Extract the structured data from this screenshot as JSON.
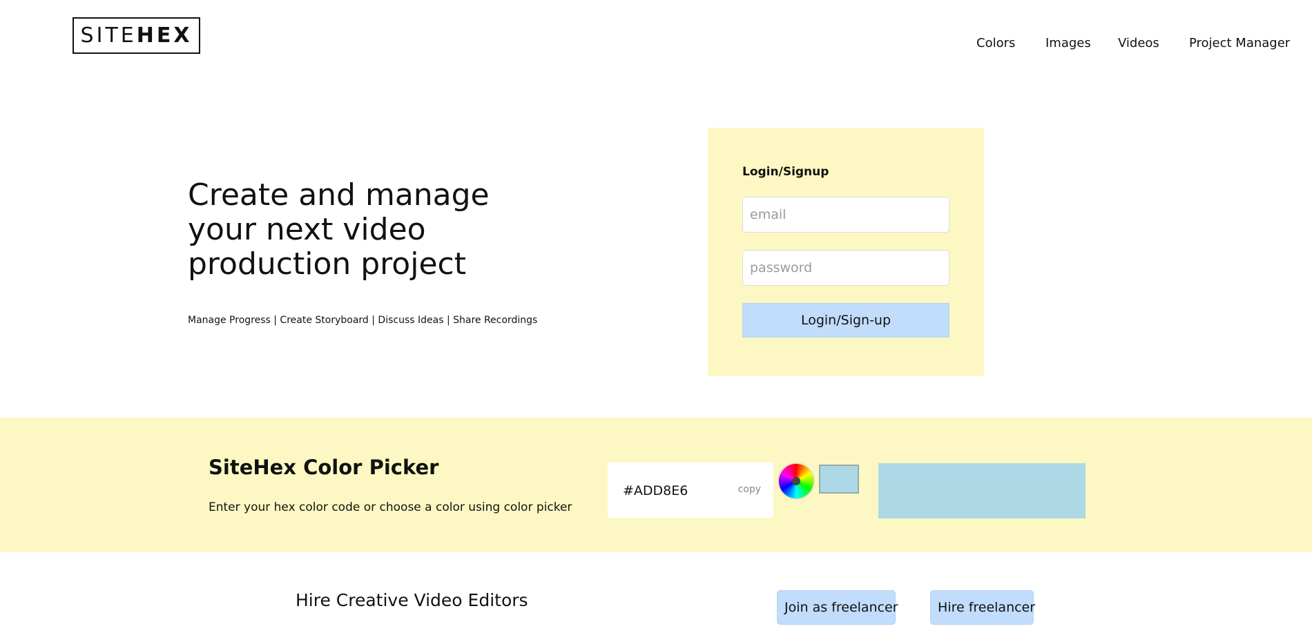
{
  "header": {
    "logo_thin": "SITE",
    "logo_bold": "HEX",
    "nav": [
      "Colors",
      "Images",
      "Videos",
      "Project Manager"
    ]
  },
  "hero": {
    "title_lines": [
      "Create and manage",
      "your next video",
      "production project"
    ],
    "subtitle": "Manage Progress | Create Storyboard | Discuss Ideas | Share Recordings"
  },
  "login": {
    "title": "Login/Signup",
    "email_placeholder": "email",
    "password_placeholder": "password",
    "button_label": "Login/Sign-up"
  },
  "color_picker": {
    "title": "SiteHex Color Picker",
    "description": "Enter your hex color code or choose a color using color picker",
    "hex_value": "#ADD8E6",
    "copy_label": "copy",
    "selected_color": "#ADD8E6",
    "wheel_icon": "color-wheel-icon"
  },
  "hire": {
    "title": "Hire Creative Video Editors",
    "join_label": "Join as freelancer",
    "hire_label": "Hire freelancer"
  },
  "colors": {
    "band_bg": "#FDF8C3",
    "button_bg": "#C2DCFB"
  }
}
